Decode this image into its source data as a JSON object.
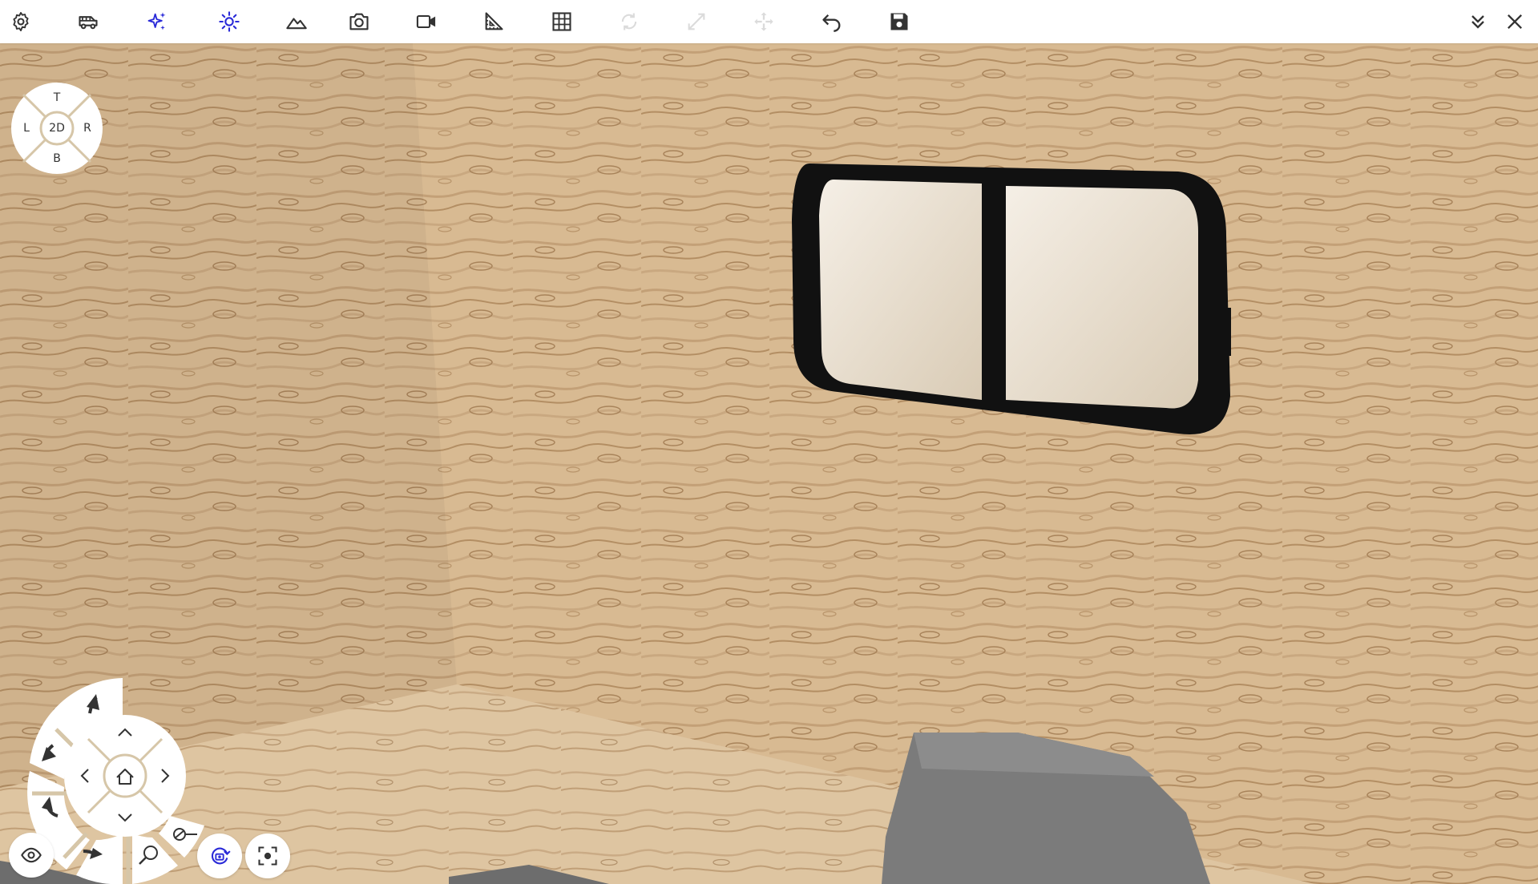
{
  "toolbar": {
    "left_icons": [
      {
        "name": "settings-icon",
        "enabled": true
      },
      {
        "name": "van-icon",
        "enabled": true
      },
      {
        "name": "sparkle-icon",
        "enabled": true,
        "active": true
      },
      {
        "name": "sun-icon",
        "enabled": true,
        "active": true
      },
      {
        "name": "terrain-icon",
        "enabled": true
      },
      {
        "name": "camera-icon",
        "enabled": true
      },
      {
        "name": "video-camera-icon",
        "enabled": true
      },
      {
        "name": "ruler-angle-icon",
        "enabled": true
      },
      {
        "name": "grid-icon",
        "enabled": true
      },
      {
        "name": "rotate-icon",
        "enabled": false
      },
      {
        "name": "scale-arrows-icon",
        "enabled": false
      },
      {
        "name": "move-arrows-icon",
        "enabled": false
      },
      {
        "name": "undo-icon",
        "enabled": true
      },
      {
        "name": "save-icon",
        "enabled": true
      }
    ],
    "right_icons": [
      {
        "name": "collapse-icon"
      },
      {
        "name": "close-icon"
      }
    ]
  },
  "colors": {
    "accent": "#2a2ad8",
    "icon": "#333333",
    "icon_disabled": "#bfbfbf",
    "wood": "#d6b891",
    "wood_grain": "#b8946a",
    "window_frame": "#111111",
    "seat": "#7a7a7a"
  },
  "viewcube": {
    "top": "T",
    "bottom": "B",
    "left": "L",
    "right": "R",
    "center": "2D"
  },
  "bottom_controls": {
    "visibility_icon": "eye-icon",
    "orbit_icon": "orbit-camera-icon",
    "focus_icon": "focus-frame-icon",
    "zoom_icon": "zoom-icon",
    "clip_icon": "clip-plane-icon",
    "home_icon": "home-icon"
  }
}
